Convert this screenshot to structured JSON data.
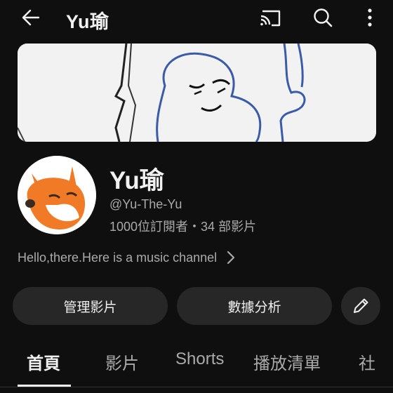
{
  "topbar": {
    "title": "Yu瑜",
    "icons": [
      "back-arrow-icon",
      "cast-icon",
      "search-icon",
      "more-vertical-icon"
    ]
  },
  "channel": {
    "name": "Yu瑜",
    "handle": "@Yu-The-Yu",
    "stats": "1000位訂閱者・34 部影片",
    "description": "Hello,there.Here is a music channel"
  },
  "actions": {
    "manage_videos": "管理影片",
    "analytics": "數據分析"
  },
  "tabs": [
    {
      "label": "首頁",
      "active": true
    },
    {
      "label": "影片",
      "active": false
    },
    {
      "label": "Shorts",
      "active": false
    },
    {
      "label": "播放清單",
      "active": false
    },
    {
      "label": "社",
      "active": false
    }
  ],
  "colors": {
    "background": "#0f0f0f",
    "text": "#f1f1f1",
    "secondary_text": "#aaaaaa",
    "pill": "#272727"
  }
}
